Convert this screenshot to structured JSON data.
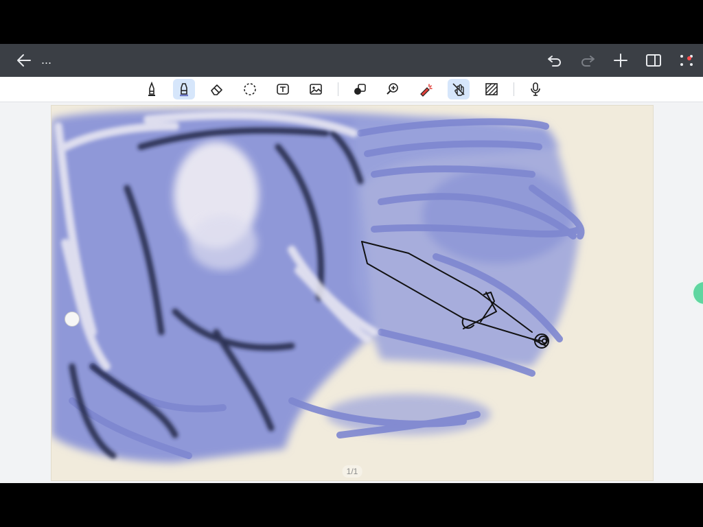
{
  "header": {
    "title": "...",
    "icons": [
      "back-icon",
      "undo-icon",
      "redo-icon",
      "add-icon",
      "sidebar-toggle-icon",
      "more-icon"
    ]
  },
  "toolbar": {
    "tools": [
      {
        "name": "pen-tool",
        "active": false
      },
      {
        "name": "marker-tool",
        "active": true
      },
      {
        "name": "eraser-tool",
        "active": false
      },
      {
        "name": "lasso-tool",
        "active": false
      },
      {
        "name": "text-tool",
        "active": false
      },
      {
        "name": "image-tool",
        "active": false
      },
      {
        "name": "shapes-tool",
        "active": false
      },
      {
        "name": "zoom-tool",
        "active": false
      },
      {
        "name": "laser-pointer-tool",
        "active": false
      },
      {
        "name": "touch-draw-toggle",
        "active": true
      },
      {
        "name": "pattern-tool",
        "active": false
      },
      {
        "name": "microphone-tool",
        "active": false
      }
    ]
  },
  "page": {
    "indicator": "1/1"
  },
  "colors": {
    "header_bg": "#3b3f45",
    "active_tool_bg": "#d6e6fb",
    "page_bg": "#f1ebdc",
    "ink_blue": "#8b94d6",
    "ink_navy": "#1b2340",
    "ink_white": "#e9e8f2"
  }
}
